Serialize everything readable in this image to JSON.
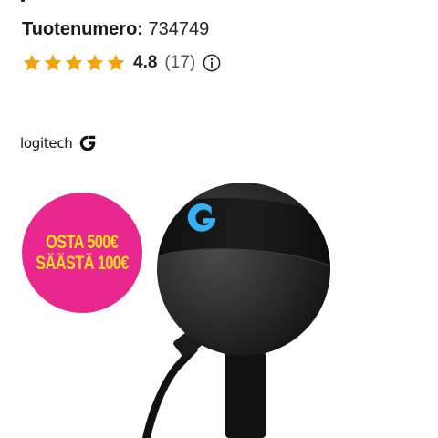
{
  "product": {
    "sku_label": "Tuotenumero:",
    "sku_value": "734749",
    "rating": {
      "stars_filled": 5,
      "stars_total": 5,
      "value": "4.8",
      "count": "(17)",
      "info_icon": "info-icon"
    },
    "brand": {
      "name": "logitech",
      "logo_icon": "logitech-g-icon"
    },
    "promo": {
      "line1": "OSTA 500€",
      "line2": "SÄÄSTÄ 100€"
    },
    "image_alt": "Logitech G microphone"
  },
  "colors": {
    "star": "#f2a20c",
    "promo_bg": "#e8278f",
    "promo_text": "#ffe21a",
    "g_logo_accent": "#33b3f5"
  }
}
